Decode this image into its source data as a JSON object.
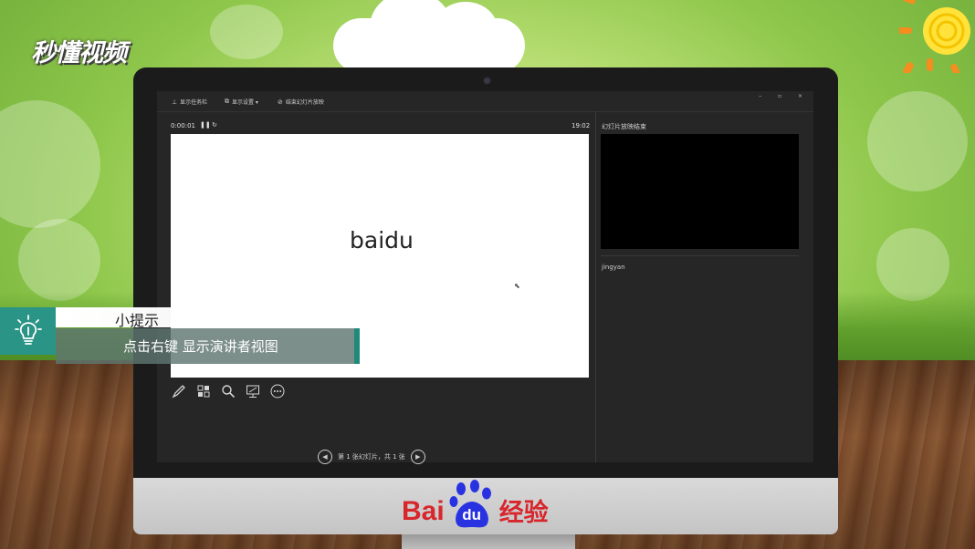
{
  "watermark": {
    "logo_text": "秒懂视频"
  },
  "presenter": {
    "toolbar": {
      "items": [
        "显示任务栏",
        "显示设置 ▾",
        "结束幻灯片放映"
      ]
    },
    "window_controls": "– ▫ ×",
    "elapsed_time": "0:00:01",
    "clock": "19:02",
    "current_slide": {
      "text": "baidu"
    },
    "next_slide_label": "幻灯片放映结束",
    "notes": "jingyan",
    "tools": [
      "pen-icon",
      "slides-grid-icon",
      "zoom-icon",
      "screen-icon",
      "more-icon"
    ],
    "navigation": {
      "label": "第 1 张幻灯片，共 1 张"
    }
  },
  "tip": {
    "title": "小提示",
    "body": "点击右键 显示演讲者视图"
  },
  "brand": {
    "bai": "Bai",
    "du": "du",
    "jingyan": "经验"
  },
  "colors": {
    "tip_accent": "#2a9486",
    "brand_red": "#d7262c",
    "brand_blue": "#2932e1"
  }
}
